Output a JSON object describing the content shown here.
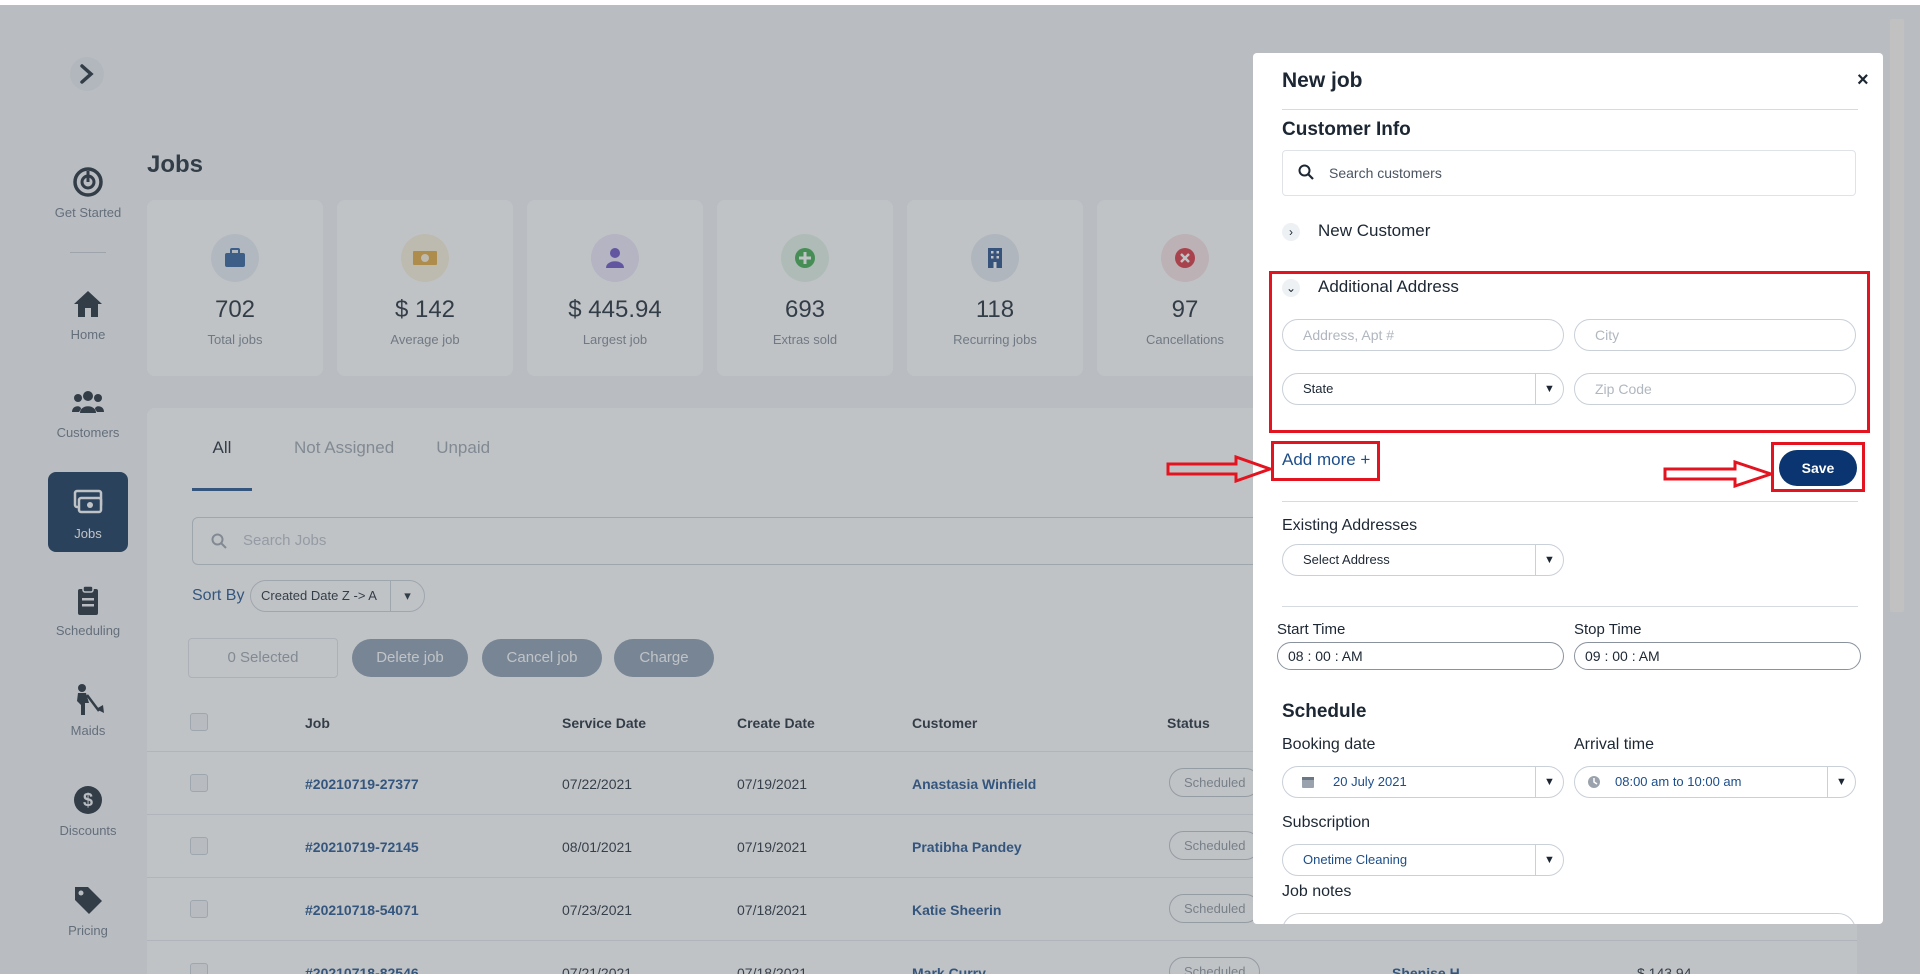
{
  "sidebar": {
    "items": [
      {
        "label": "Get Started",
        "icon": "power-icon"
      },
      {
        "label": "Home",
        "icon": "home-icon"
      },
      {
        "label": "Customers",
        "icon": "users-icon"
      },
      {
        "label": "Jobs",
        "icon": "jobs-icon"
      },
      {
        "label": "Scheduling",
        "icon": "clipboard-icon"
      },
      {
        "label": "Maids",
        "icon": "maid-icon"
      },
      {
        "label": "Discounts",
        "icon": "dollar-icon"
      },
      {
        "label": "Pricing",
        "icon": "tag-icon"
      }
    ]
  },
  "page": {
    "title": "Jobs"
  },
  "stats": [
    {
      "value": "702",
      "label": "Total jobs",
      "color": "#2a5c9a"
    },
    {
      "value": "$ 142",
      "label": "Average job",
      "color": "#e2a93b"
    },
    {
      "value": "$ 445.94",
      "label": "Largest job",
      "color": "#6a4fc2"
    },
    {
      "value": "693",
      "label": "Extras sold",
      "color": "#3ca84b"
    },
    {
      "value": "118",
      "label": "Recurring jobs",
      "color": "#234a86"
    },
    {
      "value": "97",
      "label": "Cancellations",
      "color": "#d9303a"
    }
  ],
  "tabs": [
    "All",
    "Not Assigned",
    "Unpaid"
  ],
  "search_jobs": {
    "placeholder": "Search Jobs"
  },
  "sort": {
    "label": "Sort By",
    "value": "Created Date Z -> A"
  },
  "bulk": {
    "selected": "0 Selected",
    "delete": "Delete job",
    "cancel": "Cancel job",
    "charge": "Charge"
  },
  "table": {
    "headers": [
      "Job",
      "Service Date",
      "Create Date",
      "Customer",
      "Status"
    ],
    "rows": [
      {
        "job": "#20210719-27377",
        "service": "07/22/2021",
        "created": "07/19/2021",
        "customer": "Anastasia Winfield",
        "status": "Scheduled"
      },
      {
        "job": "#20210719-72145",
        "service": "08/01/2021",
        "created": "07/19/2021",
        "customer": "Pratibha Pandey",
        "status": "Scheduled"
      },
      {
        "job": "#20210718-54071",
        "service": "07/23/2021",
        "created": "07/18/2021",
        "customer": "Katie Sheerin",
        "status": "Scheduled"
      },
      {
        "job": "#20210718-82546",
        "service": "07/21/2021",
        "created": "07/18/2021",
        "customer": "Mark Curry",
        "status": "Scheduled",
        "assignee": "Shenise H",
        "amount": "$ 143.94"
      }
    ]
  },
  "modal": {
    "title": "New job",
    "close": "×",
    "customer_info": "Customer Info",
    "search_placeholder": "Search customers",
    "new_customer": "New Customer",
    "additional_address": "Additional Address",
    "address_placeholder": "Address, Apt #",
    "city_placeholder": "City",
    "state_value": "State",
    "zip_placeholder": "Zip Code",
    "add_more": "Add more +",
    "save": "Save",
    "existing_addresses": "Existing Addresses",
    "select_address": "Select Address",
    "start_time_label": "Start Time",
    "start_time_value": "08 : 00 : AM",
    "stop_time_label": "Stop Time",
    "stop_time_value": "09 : 00 : AM",
    "schedule": "Schedule",
    "booking_date_label": "Booking date",
    "booking_date_value": "20 July 2021",
    "arrival_time_label": "Arrival time",
    "arrival_time_value": "08:00 am to 10:00 am",
    "subscription_label": "Subscription",
    "subscription_value": "Onetime Cleaning",
    "job_notes_label": "Job notes"
  },
  "colors": {
    "primary": "#0a3570",
    "highlight": "#e3131f",
    "link": "#1d4e89"
  }
}
